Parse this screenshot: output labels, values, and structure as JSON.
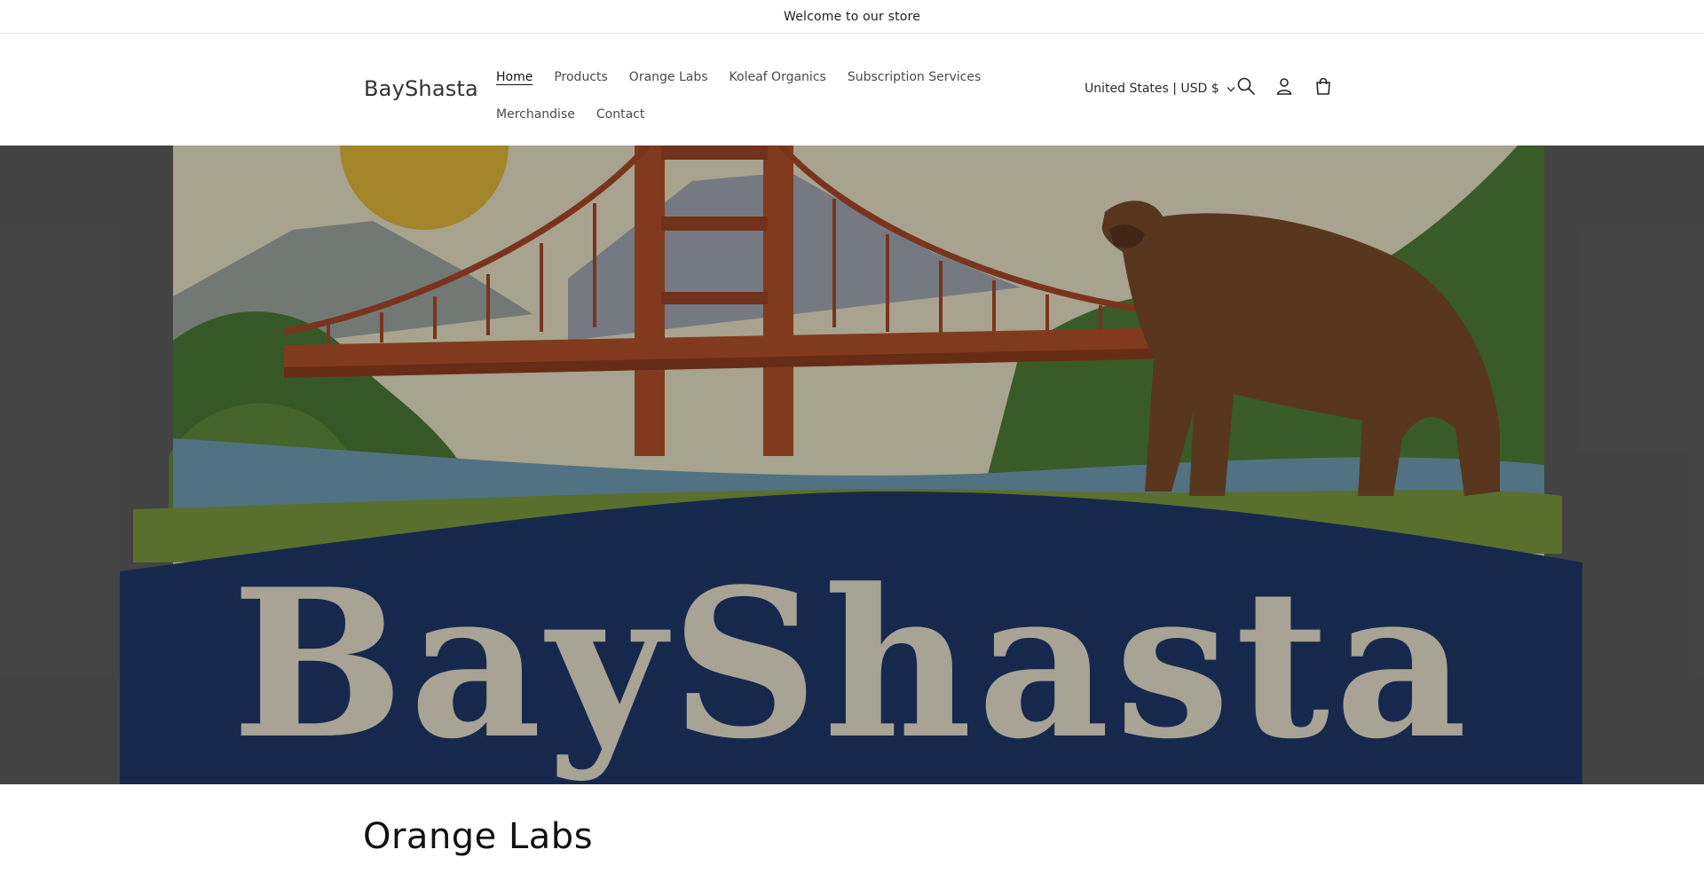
{
  "announcement": {
    "text": "Welcome to our store"
  },
  "header": {
    "logo": "BayShasta",
    "nav": [
      {
        "label": "Home",
        "active": true
      },
      {
        "label": "Products"
      },
      {
        "label": "Orange Labs"
      },
      {
        "label": "Koleaf Organics"
      },
      {
        "label": "Subscription Services"
      },
      {
        "label": "Merchandise"
      },
      {
        "label": "Contact"
      }
    ],
    "locale": "United States | USD $",
    "icons": [
      "search-icon",
      "account-icon",
      "cart-icon"
    ]
  },
  "hero": {
    "image_text": "BayShasta",
    "colors": {
      "sky": "#e8e2c6",
      "banner": "#1f3a6b",
      "bridge": "#b4512a",
      "grass": "#5f8b3c",
      "sun": "#e2b93b",
      "bear": "#7a4b2a"
    }
  },
  "main": {
    "section_title": "Orange Labs"
  }
}
